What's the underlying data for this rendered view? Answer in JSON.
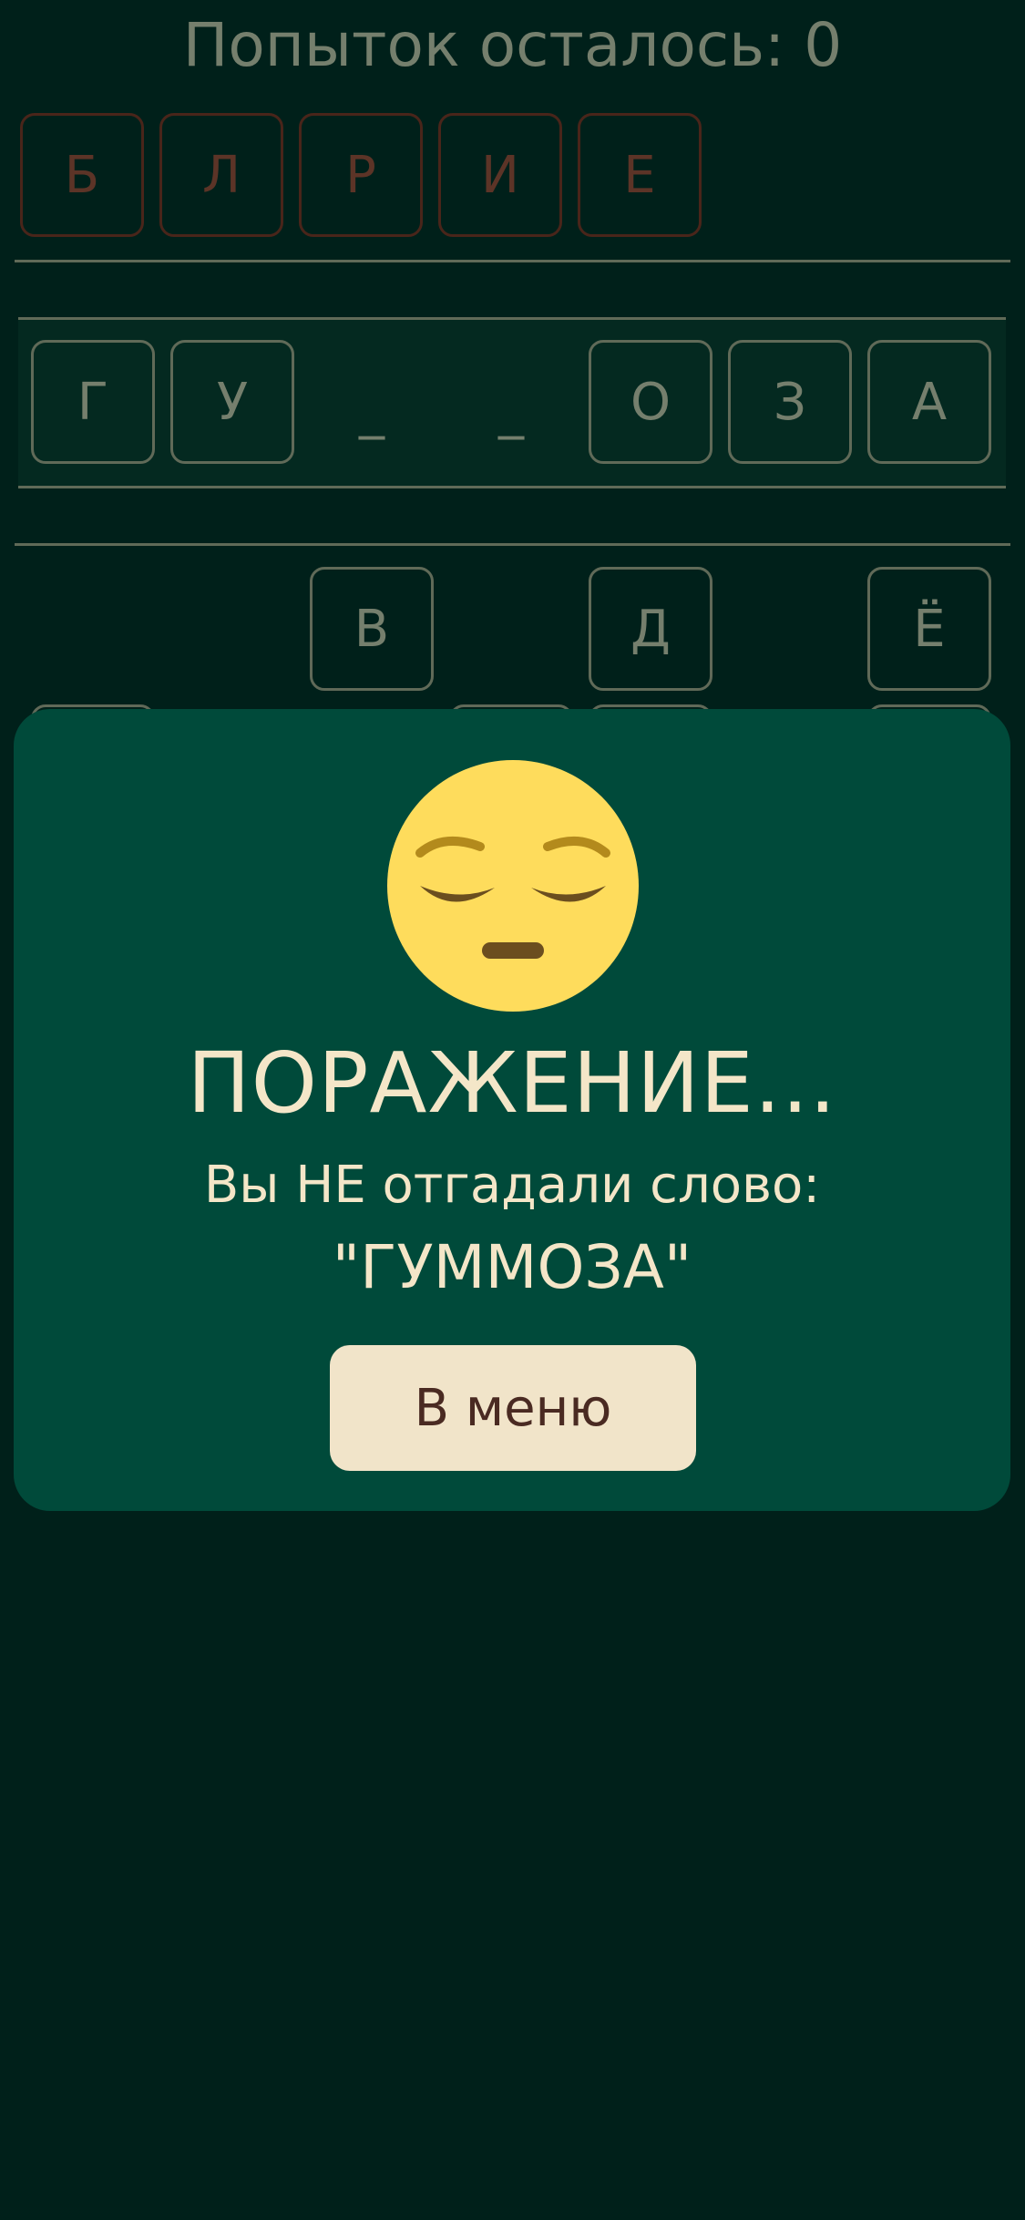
{
  "header": {
    "attempts_text": "Попыток осталось: 0"
  },
  "wrong_letters": [
    "Б",
    "Л",
    "Р",
    "И",
    "Е"
  ],
  "word_slots": [
    {
      "letter": "Г",
      "revealed": true
    },
    {
      "letter": "У",
      "revealed": true
    },
    {
      "letter": "_",
      "revealed": false
    },
    {
      "letter": "_",
      "revealed": false
    },
    {
      "letter": "О",
      "revealed": true
    },
    {
      "letter": "З",
      "revealed": true
    },
    {
      "letter": "А",
      "revealed": true
    }
  ],
  "keyboard_visible_keys": [
    "В",
    "Д",
    "Ё"
  ],
  "modal": {
    "emoji_icon": "pensive-face",
    "title": "ПОРАЖЕНИЕ...",
    "subtitle": "Вы НЕ отгадали слово:",
    "answer": "\"ГУММОЗА\"",
    "menu_button_label": "В меню"
  },
  "colors": {
    "background": "#00201a",
    "modal_background": "#004a3a",
    "text": "#f4e6c8",
    "wrong_border": "#9a2c1c",
    "button_background": "#f1e4c9",
    "button_text": "#4a2a22",
    "emoji_yellow": "#fedc5c"
  }
}
